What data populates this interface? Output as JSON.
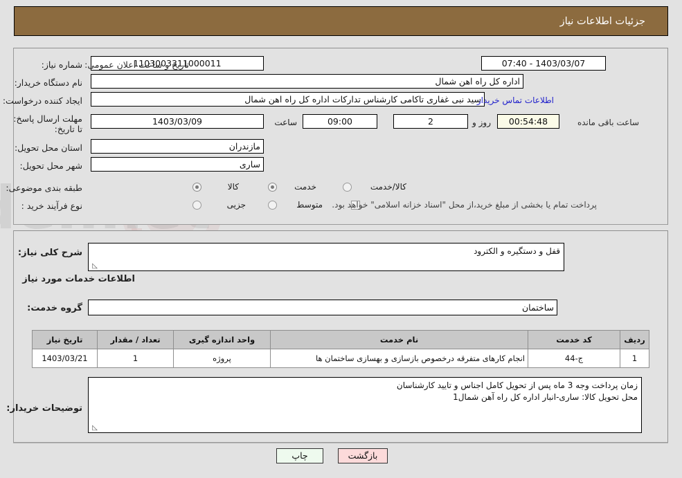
{
  "header": {
    "title": "جزئیات اطلاعات نیاز"
  },
  "form": {
    "need_number_label": "شماره نیاز:",
    "need_number_value": "1103003311000011",
    "announce_label": "تاریخ و ساعت اعلان عمومی:",
    "announce_value": "1403/03/07 - 07:40",
    "buyer_org_label": "نام دستگاه خریدار:",
    "buyer_org_value": "اداره کل راه اهن شمال",
    "creator_label": "ایجاد کننده درخواست:",
    "creator_value": "سید نبی غفاری تاکامی کارشناس تدارکات اداره کل راه اهن شمال",
    "contact_link": "اطلاعات تماس خریدار",
    "deadline_label": "مهلت ارسال پاسخ: تا تاریخ:",
    "deadline_date": "1403/03/09",
    "deadline_time_label": "ساعت",
    "deadline_time": "09:00",
    "remaining_days": "2",
    "days_and_label": "روز و",
    "remaining_time": "00:54:48",
    "remaining_suffix": "ساعت باقی مانده",
    "province_label": "استان محل تحویل:",
    "province_value": "مازندران",
    "city_label": "شهر محل تحویل:",
    "city_value": "ساری",
    "category_label": "طبقه بندی موضوعی:",
    "category_options": [
      {
        "label": "کالا",
        "selected": false
      },
      {
        "label": "خدمت",
        "selected": true
      },
      {
        "label": "کالا/خدمت",
        "selected": false
      }
    ],
    "process_label": "نوع فرآیند خرید :",
    "process_options": [
      {
        "label": "جزیی",
        "selected": false
      },
      {
        "label": "متوسط",
        "selected": false
      }
    ],
    "treasury_checkbox_text": "پرداخت تمام یا بخشی از مبلغ خرید،از محل \"اسناد خزانه اسلامی\" خواهد بود.",
    "treasury_checked": false
  },
  "details": {
    "general_desc_label": "شرح کلی نیاز:",
    "general_desc_value": "قفل و دستگیره و الکترود",
    "services_section_title": "اطلاعات خدمات مورد نیاز",
    "service_group_label": "گروه خدمت:",
    "service_group_value": "ساختمان",
    "buyer_notes_label": "توضیحات خریدار:",
    "buyer_notes_value": "زمان پرداخت وجه 3 ماه پس از تحویل کامل اجناس و تایید کارشناسان\nمحل تحویل کالا: ساری-انبار اداره کل راه آهن شمال1"
  },
  "table": {
    "headers": [
      "ردیف",
      "کد خدمت",
      "نام خدمت",
      "واحد اندازه گیری",
      "تعداد / مقدار",
      "تاریخ نیاز"
    ],
    "rows": [
      {
        "row_no": "1",
        "service_code": "ج-44",
        "service_name": "انجام کارهای متفرقه درخصوص بازسازی و بهسازی ساختمان ها",
        "unit": "پروژه",
        "quantity": "1",
        "need_date": "1403/03/21"
      }
    ]
  },
  "footer": {
    "print_label": "چاپ",
    "back_label": "بازگشت"
  },
  "colors": {
    "header_bg": "#8c6b3f",
    "page_bg": "#e2e2e2",
    "link": "#2222cc",
    "table_header_bg": "#c8c8c8",
    "print_btn_bg": "#eefaee",
    "back_btn_bg": "#fcdada"
  }
}
